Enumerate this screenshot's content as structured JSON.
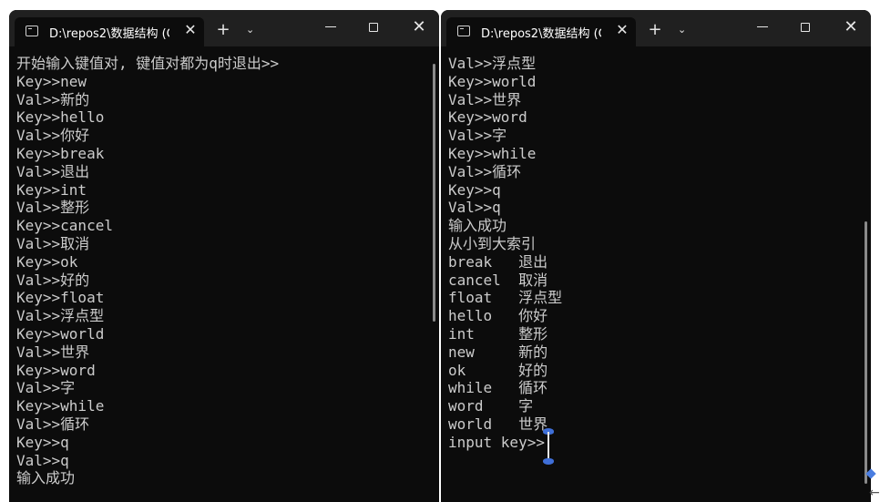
{
  "left": {
    "tab_title": "D:\\repos2\\数据结构 (C",
    "tab_close": "✕",
    "new_tab": "+",
    "dropdown": "⌄",
    "close": "✕",
    "lines": [
      "开始输入键值对, 键值对都为q时退出>>",
      "Key>>new",
      "Val>>新的",
      "Key>>hello",
      "Val>>你好",
      "Key>>break",
      "Val>>退出",
      "Key>>int",
      "Val>>整形",
      "Key>>cancel",
      "Val>>取消",
      "Key>>ok",
      "Val>>好的",
      "Key>>float",
      "Val>>浮点型",
      "Key>>world",
      "Val>>世界",
      "Key>>word",
      "Val>>字",
      "Key>>while",
      "Val>>循环",
      "Key>>q",
      "Val>>q",
      "输入成功"
    ]
  },
  "right": {
    "tab_title": "D:\\repos2\\数据结构 (C",
    "tab_close": "✕",
    "new_tab": "+",
    "dropdown": "⌄",
    "close": "✕",
    "lines": [
      "Val>>浮点型",
      "Key>>world",
      "Val>>世界",
      "Key>>word",
      "Val>>字",
      "Key>>while",
      "Val>>循环",
      "Key>>q",
      "Val>>q",
      "输入成功",
      "从小到大索引",
      "break   退出",
      "cancel  取消",
      "float   浮点型",
      "hello   你好",
      "int     整形",
      "new     新的",
      "ok      好的",
      "while   循环",
      "word    字",
      "world   世界",
      "input key>>"
    ]
  },
  "icons": {
    "tab_icon": "terminal-icon",
    "minimize": "minimize-icon",
    "maximize": "maximize-icon",
    "close": "close-icon"
  },
  "colors": {
    "console_bg": "#0c0c0c",
    "titlebar_bg": "#202020",
    "text": "#cccccc"
  }
}
